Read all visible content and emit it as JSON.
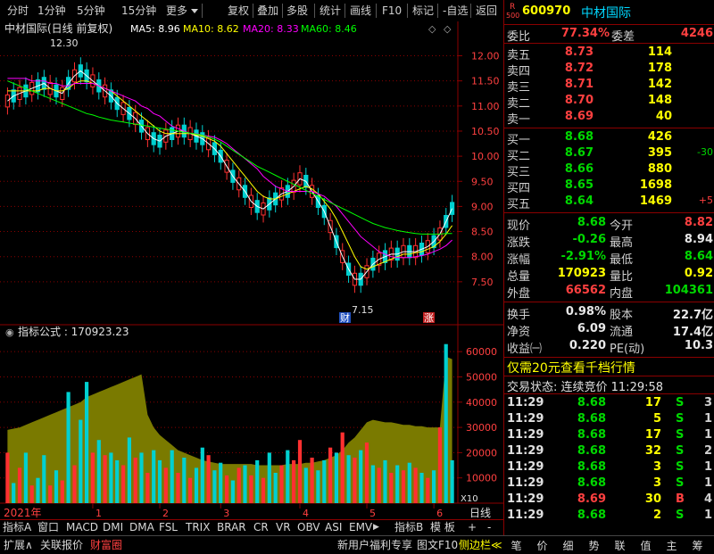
{
  "toolbar": {
    "left_items": [
      "分时",
      "1分钟",
      "5分钟",
      "15分钟",
      "更多"
    ],
    "right_items": [
      "复权",
      "叠加",
      "多股",
      "统计",
      "画线",
      "F10",
      "标记",
      "-自选",
      "返回"
    ]
  },
  "chart_header": {
    "title": "中材国际(日线 前复权)",
    "ma5": "MA5: 8.96",
    "ma10": "MA10: 8.62",
    "ma20": "MA20: 8.33",
    "ma60": "MA60: 8.46",
    "indicator": "指标公式 : 170923.23",
    "high_label": "12.30",
    "low_label": "7.15",
    "mark_cai": "财",
    "mark_zhang": "涨",
    "vol_unit": "X10",
    "year_label": "2021年",
    "month_labels": [
      "1",
      "2",
      "3",
      "4",
      "5",
      "6"
    ],
    "period_label": "日线"
  },
  "colors": {
    "up": "#ff3030",
    "down": "#00d0d0",
    "ma5": "#ffffff",
    "ma10": "#ffff00",
    "ma20": "#ff00ff",
    "ma60": "#00ff00",
    "grid": "#8b0000",
    "vol_area": "#7a7a00"
  },
  "chart_data": {
    "type": "candlestick",
    "price_axis": {
      "min": 7.0,
      "max": 12.4,
      "ticks": [
        7.5,
        8.0,
        8.5,
        9.0,
        9.5,
        10.0,
        10.5,
        11.0,
        11.5,
        12.0
      ]
    },
    "price_tick_labels": [
      "7.50",
      "8.00",
      "8.50",
      "9.00",
      "9.50",
      "10.00",
      "10.50",
      "11.00",
      "11.50",
      "12.00"
    ],
    "volume_axis": {
      "min": 0,
      "max": 65000,
      "ticks": [
        10000,
        20000,
        30000,
        40000,
        50000,
        60000
      ]
    },
    "volume_tick_labels": [
      "10000",
      "20000",
      "30000",
      "40000",
      "50000",
      "60000"
    ],
    "series": [
      {
        "name": "MA5",
        "values": [
          11.1,
          11.2,
          11.25,
          11.3,
          11.35,
          11.4,
          11.45,
          11.35,
          11.3,
          11.25,
          11.45,
          11.6,
          11.7,
          11.6,
          11.5,
          11.4,
          11.3,
          11.2,
          11.05,
          10.95,
          10.85,
          10.75,
          10.6,
          10.45,
          10.35,
          10.3,
          10.4,
          10.45,
          10.5,
          10.5,
          10.45,
          10.4,
          10.35,
          10.25,
          10.15,
          10.0,
          9.8,
          9.6,
          9.45,
          9.3,
          9.1,
          9.0,
          8.95,
          9.05,
          9.15,
          9.25,
          9.3,
          9.4,
          9.55,
          9.5,
          9.3,
          9.1,
          8.9,
          8.6,
          8.3,
          8.0,
          7.75,
          7.55,
          7.55,
          7.7,
          7.85,
          7.95,
          8.0,
          8.05,
          8.05,
          8.1,
          8.1,
          8.1,
          8.15,
          8.2,
          8.3,
          8.45,
          8.7,
          8.96
        ]
      },
      {
        "name": "MA10",
        "values": [
          11.3,
          11.3,
          11.3,
          11.3,
          11.3,
          11.3,
          11.35,
          11.35,
          11.3,
          11.3,
          11.35,
          11.45,
          11.5,
          11.5,
          11.45,
          11.4,
          11.35,
          11.3,
          11.2,
          11.1,
          11.0,
          10.9,
          10.8,
          10.7,
          10.6,
          10.5,
          10.45,
          10.45,
          10.45,
          10.45,
          10.45,
          10.42,
          10.4,
          10.35,
          10.3,
          10.2,
          10.05,
          9.9,
          9.75,
          9.6,
          9.45,
          9.3,
          9.2,
          9.15,
          9.15,
          9.2,
          9.25,
          9.3,
          9.35,
          9.4,
          9.35,
          9.25,
          9.1,
          8.95,
          8.75,
          8.5,
          8.25,
          8.0,
          7.8,
          7.75,
          7.8,
          7.85,
          7.9,
          7.95,
          8.0,
          8.05,
          8.05,
          8.08,
          8.1,
          8.15,
          8.2,
          8.3,
          8.45,
          8.62
        ]
      },
      {
        "name": "MA20",
        "values": [
          11.55,
          11.55,
          11.55,
          11.55,
          11.5,
          11.5,
          11.5,
          11.45,
          11.45,
          11.4,
          11.4,
          11.45,
          11.45,
          11.45,
          11.45,
          11.4,
          11.35,
          11.3,
          11.25,
          11.2,
          11.15,
          11.1,
          11.0,
          10.95,
          10.85,
          10.8,
          10.7,
          10.6,
          10.55,
          10.5,
          10.45,
          10.45,
          10.42,
          10.4,
          10.38,
          10.32,
          10.25,
          10.15,
          10.05,
          9.95,
          9.85,
          9.75,
          9.6,
          9.5,
          9.4,
          9.35,
          9.3,
          9.3,
          9.3,
          9.3,
          9.3,
          9.25,
          9.2,
          9.1,
          9.0,
          8.85,
          8.7,
          8.55,
          8.4,
          8.3,
          8.2,
          8.1,
          8.05,
          8.0,
          7.98,
          7.98,
          7.98,
          8.0,
          8.02,
          8.05,
          8.1,
          8.15,
          8.22,
          8.33
        ]
      },
      {
        "name": "MA60",
        "values": [
          11.5,
          11.45,
          11.4,
          11.35,
          11.3,
          11.25,
          11.2,
          11.15,
          11.1,
          11.05,
          11.0,
          10.95,
          10.9,
          10.85,
          10.82,
          10.78,
          10.75,
          10.72,
          10.7,
          10.68,
          10.66,
          10.64,
          10.62,
          10.6,
          10.58,
          10.56,
          10.54,
          10.52,
          10.5,
          10.48,
          10.46,
          10.44,
          10.42,
          10.38,
          10.34,
          10.28,
          10.2,
          10.12,
          10.04,
          9.96,
          9.88,
          9.8,
          9.74,
          9.68,
          9.62,
          9.56,
          9.5,
          9.44,
          9.38,
          9.32,
          9.26,
          9.2,
          9.14,
          9.08,
          9.02,
          8.96,
          8.9,
          8.84,
          8.78,
          8.72,
          8.66,
          8.62,
          8.58,
          8.55,
          8.52,
          8.5,
          8.48,
          8.46,
          8.45,
          8.45,
          8.45,
          8.45,
          8.46,
          8.46
        ]
      },
      {
        "name": "VOL_AREA",
        "values": [
          29000,
          29500,
          30000,
          31000,
          32000,
          33000,
          34000,
          35000,
          36000,
          37000,
          38000,
          39000,
          40000,
          42000,
          43000,
          44000,
          45000,
          46000,
          47000,
          48000,
          49000,
          50000,
          51000,
          35000,
          30000,
          27000,
          25000,
          23000,
          21000,
          20000,
          19000,
          18000,
          17000,
          16500,
          16000,
          15500,
          15500,
          15500,
          15500,
          15500,
          15500,
          15000,
          15000,
          15000,
          15000,
          15000,
          15500,
          15500,
          15500,
          16000,
          16000,
          16500,
          17000,
          18000,
          19000,
          21000,
          24000,
          26000,
          29000,
          32000,
          33000,
          32500,
          32000,
          32000,
          31500,
          31000,
          31000,
          30500,
          30500,
          30000,
          30000,
          30000,
          58000,
          57000
        ]
      }
    ],
    "volumes": [
      20000,
      8000,
      14000,
      20000,
      7000,
      10000,
      19000,
      7000,
      13000,
      9000,
      44000,
      15000,
      33000,
      48000,
      20000,
      25000,
      19000,
      20000,
      17000,
      15000,
      26000,
      18000,
      20000,
      12000,
      21000,
      17000,
      14000,
      21000,
      12000,
      18000,
      10000,
      14000,
      22000,
      19000,
      13000,
      16000,
      11000,
      9000,
      14000,
      15000,
      11000,
      17000,
      10000,
      20000,
      12000,
      15000,
      21000,
      17000,
      25000,
      14000,
      18000,
      13000,
      17000,
      22000,
      20000,
      28000,
      19000,
      18000,
      21000,
      24000,
      15000,
      14000,
      17000,
      12000,
      15000,
      13000,
      16000,
      14000,
      12000,
      10000,
      13000,
      30000,
      63000,
      17000
    ],
    "volume_up": [
      true,
      false,
      true,
      false,
      true,
      false,
      false,
      true,
      false,
      true,
      false,
      true,
      false,
      false,
      true,
      false,
      true,
      false,
      false,
      true,
      false,
      true,
      false,
      true,
      false,
      false,
      true,
      false,
      true,
      false,
      true,
      false,
      false,
      true,
      false,
      false,
      true,
      false,
      true,
      false,
      true,
      false,
      true,
      false,
      false,
      true,
      false,
      true,
      true,
      false,
      true,
      false,
      false,
      true,
      false,
      true,
      false,
      true,
      false,
      true,
      false,
      true,
      false,
      true,
      false,
      true,
      false,
      true,
      false,
      true,
      false,
      true,
      false,
      false
    ]
  },
  "stock": {
    "r_badge": "R",
    "code_badge": "500",
    "code": "600970",
    "name": "中材国际",
    "weibi_label": "委比",
    "weibi": "77.34%",
    "weicha_label": "委差",
    "weicha": "4246"
  },
  "sell": [
    {
      "label": "卖五",
      "price": "8.73",
      "vol": "114"
    },
    {
      "label": "卖四",
      "price": "8.72",
      "vol": "178"
    },
    {
      "label": "卖三",
      "price": "8.71",
      "vol": "142"
    },
    {
      "label": "卖二",
      "price": "8.70",
      "vol": "148"
    },
    {
      "label": "卖一",
      "price": "8.69",
      "vol": "40"
    }
  ],
  "buy": [
    {
      "label": "买一",
      "price": "8.68",
      "vol": "426",
      "chg": ""
    },
    {
      "label": "买二",
      "price": "8.67",
      "vol": "395",
      "chg": "-30"
    },
    {
      "label": "买三",
      "price": "8.66",
      "vol": "880",
      "chg": ""
    },
    {
      "label": "买四",
      "price": "8.65",
      "vol": "1698",
      "chg": ""
    },
    {
      "label": "买五",
      "price": "8.64",
      "vol": "1469",
      "chg": "+5"
    }
  ],
  "quote": {
    "xianjia_l": "现价",
    "xianjia": "8.68",
    "jinkai_l": "今开",
    "jinkai": "8.82",
    "zhangdie_l": "涨跌",
    "zhangdie": "-0.26",
    "zuigao_l": "最高",
    "zuigao": "8.94",
    "zhangfu_l": "涨幅",
    "zhangfu": "-2.91%",
    "zuidi_l": "最低",
    "zuidi": "8.64",
    "zongliang_l": "总量",
    "zongliang": "170923",
    "liangbi_l": "量比",
    "liangbi": "0.92",
    "waipan_l": "外盘",
    "waipan": "66562",
    "neipan_l": "内盘",
    "neipan": "104361",
    "huanshou_l": "换手",
    "huanshou": "0.98%",
    "guben_l": "股本",
    "guben": "22.7亿",
    "jingzi_l": "净资",
    "jingzi": "6.09",
    "liutong_l": "流通",
    "liutong": "17.4亿",
    "shouyi_l": "收益㈠",
    "shouyi": "0.220",
    "pe_l": "PE(动)",
    "pe": "10.3"
  },
  "promo": "仅需20元查看千档行情",
  "trade_status": "交易状态: 连续竞价 11:29:58",
  "ticks": [
    {
      "time": "11:29",
      "price": "8.68",
      "vol": "17",
      "side": "S",
      "n": "3"
    },
    {
      "time": "11:29",
      "price": "8.68",
      "vol": "5",
      "side": "S",
      "n": "1"
    },
    {
      "time": "11:29",
      "price": "8.68",
      "vol": "17",
      "side": "S",
      "n": "1"
    },
    {
      "time": "11:29",
      "price": "8.68",
      "vol": "32",
      "side": "S",
      "n": "2"
    },
    {
      "time": "11:29",
      "price": "8.68",
      "vol": "3",
      "side": "S",
      "n": "1"
    },
    {
      "time": "11:29",
      "price": "8.68",
      "vol": "3",
      "side": "S",
      "n": "1"
    },
    {
      "time": "11:29",
      "price": "8.69",
      "vol": "30",
      "side": "B",
      "n": "4"
    },
    {
      "time": "11:29",
      "price": "8.68",
      "vol": "2",
      "side": "S",
      "n": "1"
    }
  ],
  "tabs": [
    "指标A",
    "窗口",
    "MACD",
    "DMI",
    "DMA",
    "FSL",
    "TRIX",
    "BRAR",
    "CR",
    "VR",
    "OBV",
    "ASI",
    "EMV"
  ],
  "tabs_right": [
    "指标B",
    "模 板",
    "+",
    "-"
  ],
  "status_left": [
    "扩展∧",
    "关联报价",
    "财富圈"
  ],
  "status_right": [
    "新用户福利专享",
    "图文F10",
    "侧边栏≪"
  ],
  "right_tabs": [
    "笔",
    "价",
    "细",
    "势",
    "联",
    "值",
    "主",
    "筹"
  ]
}
